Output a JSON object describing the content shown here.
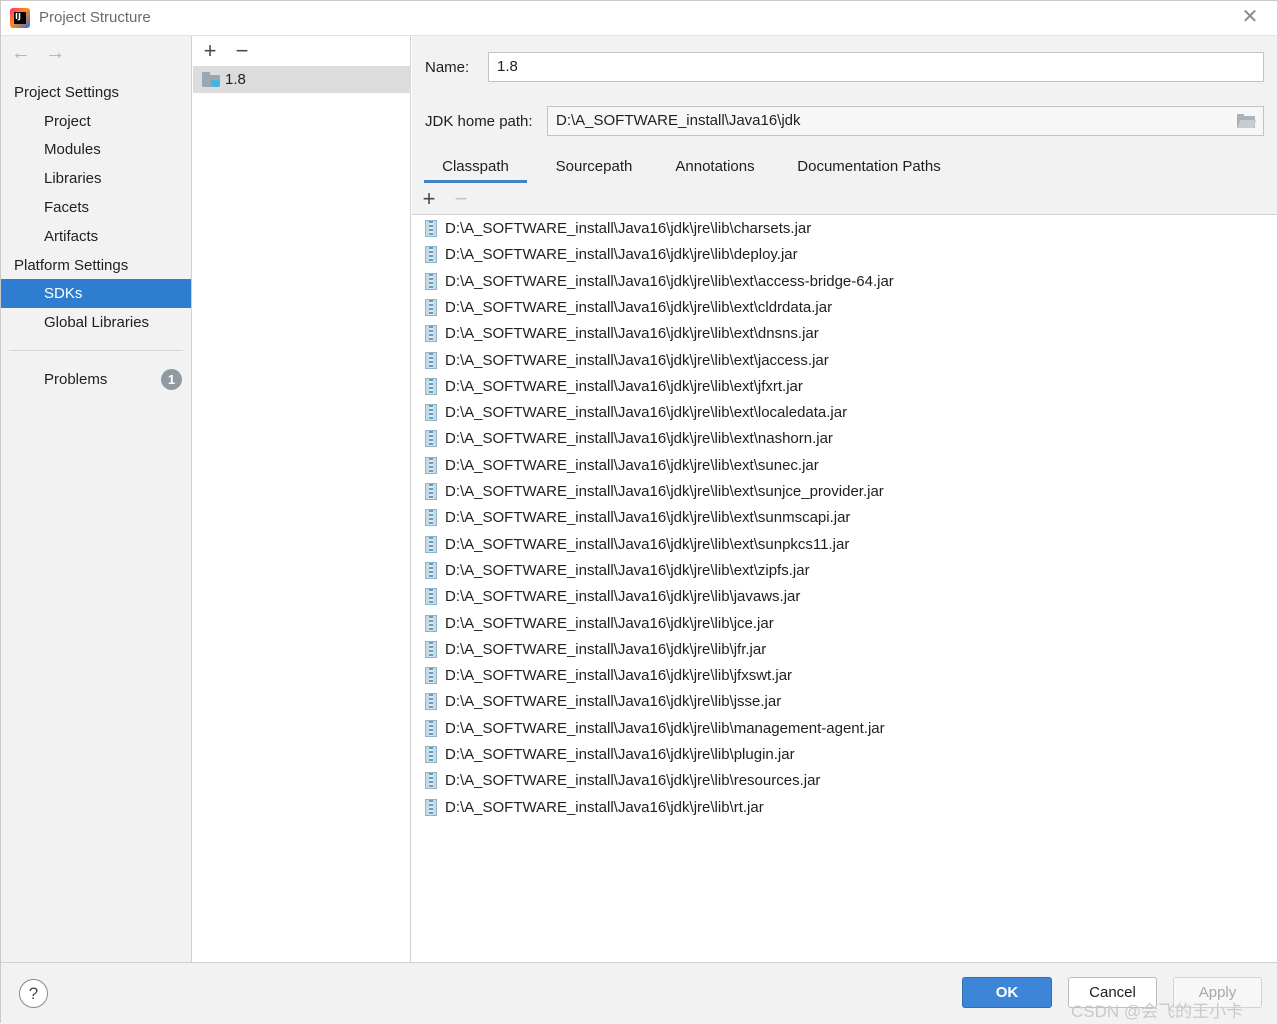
{
  "window": {
    "title": "Project Structure",
    "close_glyph": "✕"
  },
  "nav": {
    "back_glyph": "←",
    "forward_glyph": "→"
  },
  "sidebar": {
    "project_settings_header": "Project Settings",
    "project_items": [
      {
        "label": "Project"
      },
      {
        "label": "Modules"
      },
      {
        "label": "Libraries"
      },
      {
        "label": "Facets"
      },
      {
        "label": "Artifacts"
      }
    ],
    "platform_settings_header": "Platform Settings",
    "platform_items": [
      {
        "label": "SDKs",
        "selected": true
      },
      {
        "label": "Global Libraries"
      }
    ],
    "problems": {
      "label": "Problems",
      "count": "1"
    }
  },
  "sdk_list": {
    "add_glyph": "+",
    "remove_glyph": "−",
    "items": [
      {
        "label": "1.8",
        "selected": true
      }
    ]
  },
  "sdk_details": {
    "name_label": "Name:",
    "name_value": "1.8",
    "jdk_home_label": "JDK home path:",
    "jdk_home_value": "D:\\A_SOFTWARE_install\\Java16\\jdk",
    "tabs": [
      {
        "label": "Classpath",
        "active": true
      },
      {
        "label": "Sourcepath"
      },
      {
        "label": "Annotations"
      },
      {
        "label": "Documentation Paths"
      }
    ],
    "list_add_glyph": "+",
    "list_remove_glyph": "−",
    "classpath": [
      "D:\\A_SOFTWARE_install\\Java16\\jdk\\jre\\lib\\charsets.jar",
      "D:\\A_SOFTWARE_install\\Java16\\jdk\\jre\\lib\\deploy.jar",
      "D:\\A_SOFTWARE_install\\Java16\\jdk\\jre\\lib\\ext\\access-bridge-64.jar",
      "D:\\A_SOFTWARE_install\\Java16\\jdk\\jre\\lib\\ext\\cldrdata.jar",
      "D:\\A_SOFTWARE_install\\Java16\\jdk\\jre\\lib\\ext\\dnsns.jar",
      "D:\\A_SOFTWARE_install\\Java16\\jdk\\jre\\lib\\ext\\jaccess.jar",
      "D:\\A_SOFTWARE_install\\Java16\\jdk\\jre\\lib\\ext\\jfxrt.jar",
      "D:\\A_SOFTWARE_install\\Java16\\jdk\\jre\\lib\\ext\\localedata.jar",
      "D:\\A_SOFTWARE_install\\Java16\\jdk\\jre\\lib\\ext\\nashorn.jar",
      "D:\\A_SOFTWARE_install\\Java16\\jdk\\jre\\lib\\ext\\sunec.jar",
      "D:\\A_SOFTWARE_install\\Java16\\jdk\\jre\\lib\\ext\\sunjce_provider.jar",
      "D:\\A_SOFTWARE_install\\Java16\\jdk\\jre\\lib\\ext\\sunmscapi.jar",
      "D:\\A_SOFTWARE_install\\Java16\\jdk\\jre\\lib\\ext\\sunpkcs11.jar",
      "D:\\A_SOFTWARE_install\\Java16\\jdk\\jre\\lib\\ext\\zipfs.jar",
      "D:\\A_SOFTWARE_install\\Java16\\jdk\\jre\\lib\\javaws.jar",
      "D:\\A_SOFTWARE_install\\Java16\\jdk\\jre\\lib\\jce.jar",
      "D:\\A_SOFTWARE_install\\Java16\\jdk\\jre\\lib\\jfr.jar",
      "D:\\A_SOFTWARE_install\\Java16\\jdk\\jre\\lib\\jfxswt.jar",
      "D:\\A_SOFTWARE_install\\Java16\\jdk\\jre\\lib\\jsse.jar",
      "D:\\A_SOFTWARE_install\\Java16\\jdk\\jre\\lib\\management-agent.jar",
      "D:\\A_SOFTWARE_install\\Java16\\jdk\\jre\\lib\\plugin.jar",
      "D:\\A_SOFTWARE_install\\Java16\\jdk\\jre\\lib\\resources.jar",
      "D:\\A_SOFTWARE_install\\Java16\\jdk\\jre\\lib\\rt.jar"
    ]
  },
  "footer": {
    "help_glyph": "?",
    "ok_label": "OK",
    "cancel_label": "Cancel",
    "apply_label": "Apply",
    "watermark": "CSDN @会飞的王小卡"
  },
  "colors": {
    "selection": "#2f7dd1",
    "ok_button": "#3d85d6",
    "tab_underline": "#4083c9",
    "panel_background": "#f2f2f2"
  }
}
